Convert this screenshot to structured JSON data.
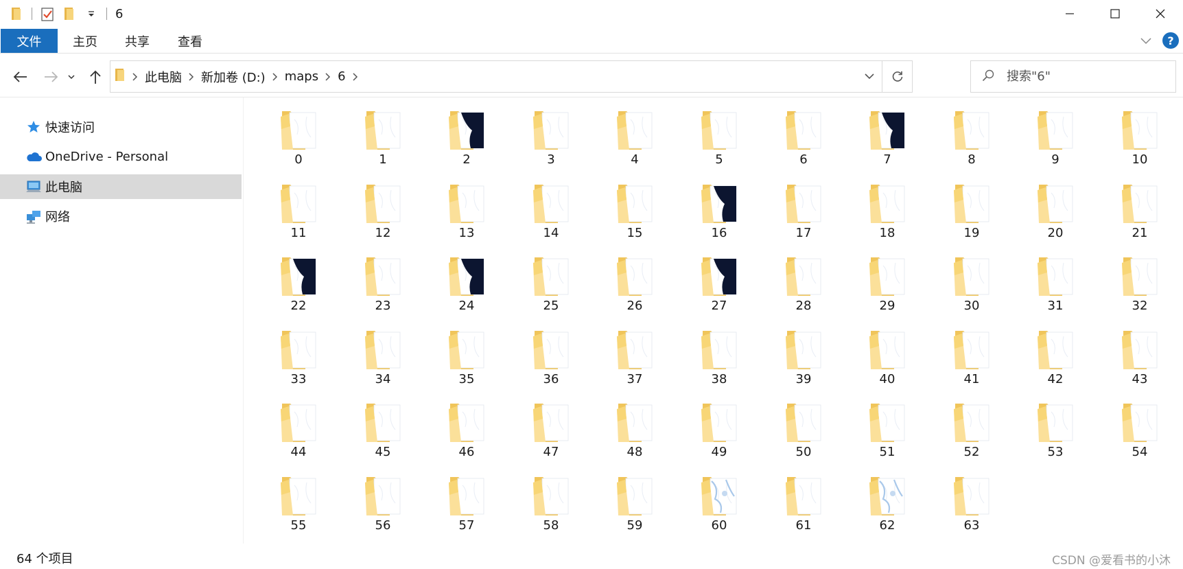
{
  "window": {
    "title": "6"
  },
  "ribbon": {
    "tabs": [
      "文件",
      "主页",
      "共享",
      "查看"
    ],
    "help_label": "?"
  },
  "address": {
    "crumbs": [
      "此电脑",
      "新加卷 (D:)",
      "maps",
      "6"
    ]
  },
  "search": {
    "placeholder": "搜索\"6\""
  },
  "sidebar": {
    "items": [
      {
        "label": "快速访问",
        "icon": "star-icon"
      },
      {
        "label": "OneDrive - Personal",
        "icon": "cloud-icon"
      },
      {
        "label": "此电脑",
        "icon": "computer-icon",
        "selected": true
      },
      {
        "label": "网络",
        "icon": "network-icon"
      }
    ]
  },
  "folders": {
    "names": [
      "0",
      "1",
      "2",
      "3",
      "4",
      "5",
      "6",
      "7",
      "8",
      "9",
      "10",
      "11",
      "12",
      "13",
      "14",
      "15",
      "16",
      "17",
      "18",
      "19",
      "20",
      "21",
      "22",
      "23",
      "24",
      "25",
      "26",
      "27",
      "28",
      "29",
      "30",
      "31",
      "32",
      "33",
      "34",
      "35",
      "36",
      "37",
      "38",
      "39",
      "40",
      "41",
      "42",
      "43",
      "44",
      "45",
      "46",
      "47",
      "48",
      "49",
      "50",
      "51",
      "52",
      "53",
      "54",
      "55",
      "56",
      "57",
      "58",
      "59",
      "60",
      "61",
      "62",
      "63"
    ],
    "dark_preview_folders": [
      "2",
      "7",
      "16",
      "22",
      "24",
      "27"
    ],
    "tinted_preview_folders": [
      "60",
      "62"
    ]
  },
  "status": {
    "item_count": "64 个项目"
  },
  "watermark": "CSDN @爱看书的小沐",
  "colors": {
    "accent": "#1a6ebd",
    "folder_back": "#f0c55a",
    "folder_front": "#fbe09a",
    "dark_preview": "#0c1530",
    "sidebar_selected": "#d9d9d9"
  }
}
